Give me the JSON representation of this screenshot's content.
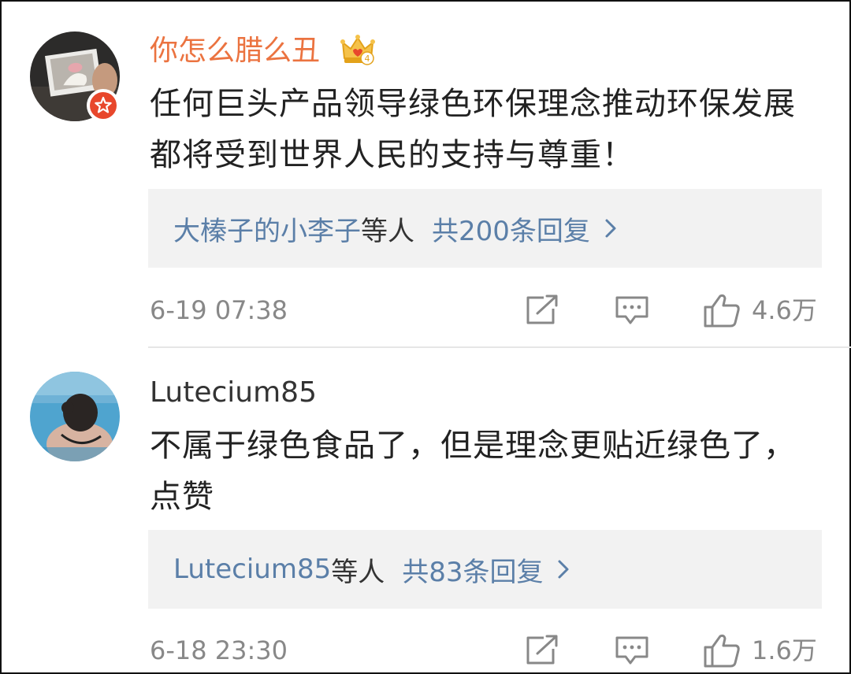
{
  "comments": [
    {
      "username": "你怎么腊么丑",
      "text": "任何巨头产品领导绿色环保理念推动环保发展都将受到世界人民的支持与尊重！",
      "replies_names": "大榛子的小李子",
      "replies_deng": "等人",
      "replies_count": "共200条回复",
      "time": "6-19 07:38",
      "likes": "4.6万",
      "vip_icon": "crown-vip-icon",
      "vip_level": "4"
    },
    {
      "username": "Lutecium85",
      "text": "不属于绿色食品了，但是理念更贴近绿色了，点赞",
      "replies_names": "Lutecium85",
      "replies_deng": "等人",
      "replies_count": "共83条回复",
      "time": "6-18 23:30",
      "likes": "1.6万"
    }
  ],
  "colors": {
    "vip_name": "#eb7340",
    "link": "#5b7fa8",
    "meta": "#888888",
    "reply_bg": "#f2f2f2",
    "badge": "#e8472c"
  }
}
